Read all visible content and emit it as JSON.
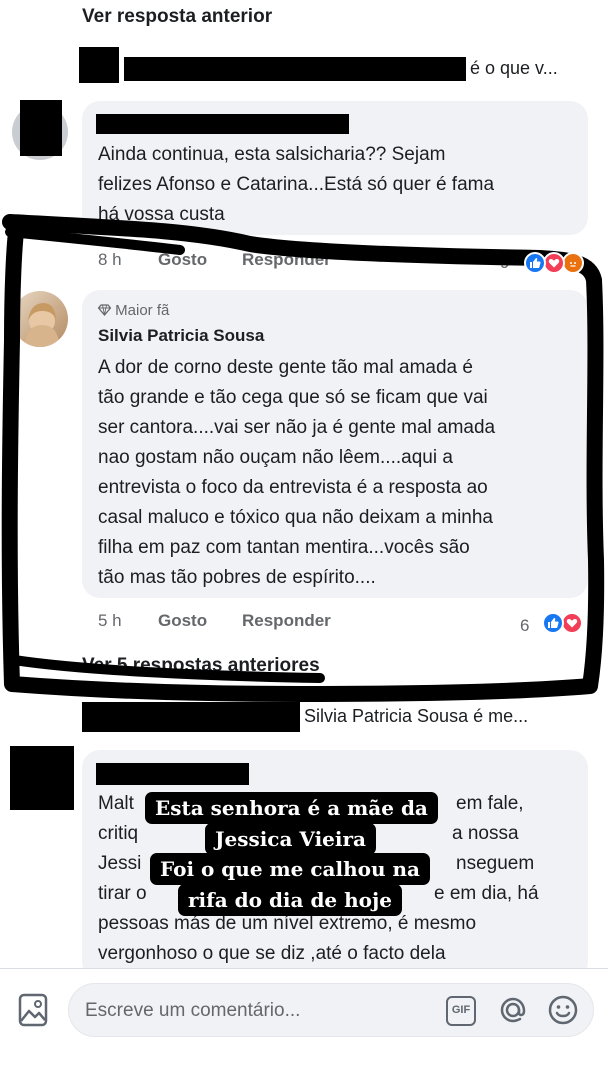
{
  "thread": {
    "view_previous_top": "Ver resposta anterior",
    "view_previous_5": "Ver 5 respostas anteriores"
  },
  "reply_preview_1": {
    "suffix": "é o que v..."
  },
  "comment_1": {
    "text_line1": "Ainda continua, esta salsicharia?? Sejam",
    "text_line2": "felizes Afonso e Catarina...Está só quer é fama",
    "text_line3": "há vossa custa",
    "time": "8 h",
    "like_label": "Gosto",
    "reply_label": "Responder",
    "reaction_count": "9"
  },
  "comment_2": {
    "badge": "Maior fã",
    "author": "Silvia Patricia Sousa",
    "lines": [
      "A dor de corno deste gente tão mal amada é",
      "tão grande e tão cega que só se ficam que vai",
      "ser cantora....vai ser não ja é  gente mal amada",
      "nao gostam não ouçam não lêem....aqui a",
      "entrevista o foco da entrevista é a resposta ao",
      "casal maluco e tóxico qua não deixam a minha",
      "filha em paz com tantan mentira...vocês são",
      "tão mas tão pobres de espírito...."
    ],
    "time": "5 h",
    "like_label": "Gosto",
    "reply_label": "Responder",
    "reaction_count": "6"
  },
  "reply_preview_2": {
    "text": "Silvia Patricia Sousa é me..."
  },
  "comment_3": {
    "lines": [
      "Malt",
      "critiq",
      "Jessi",
      "tirar o",
      "pessoas más de um nível extremo, é mesmo",
      "vergonhoso o que se diz ,até o facto dela"
    ],
    "fragments": {
      "l1_right": "em fale,",
      "l2_right": "a nossa",
      "l3_right": "nseguem",
      "l4_right": "e em dia, há"
    }
  },
  "overlay": {
    "line1": "Esta senhora é a mãe da",
    "line2": "Jessica Vieira",
    "line3": "Foi o que me calhou na",
    "line4": "rifa do dia de hoje"
  },
  "composer": {
    "placeholder": "Escreve um comentário...",
    "gif_label": "GIF"
  },
  "colors": {
    "like_blue": "#1877f2",
    "love_red": "#f33e58",
    "angry_orange": "#e9710f",
    "bubble_gray": "#f0f2f5",
    "meta_gray": "#65676b"
  }
}
